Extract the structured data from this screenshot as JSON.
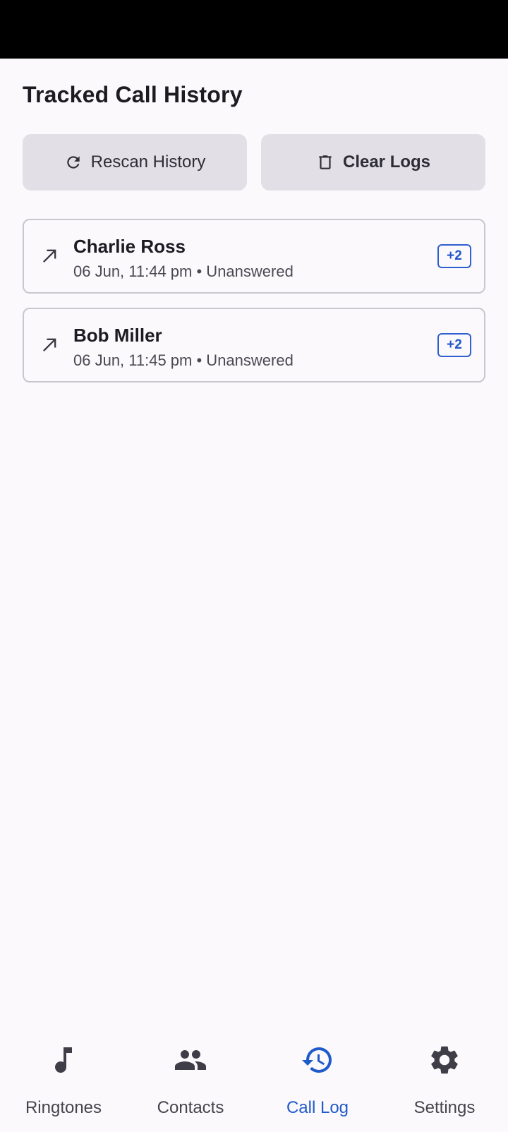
{
  "page": {
    "title": "Tracked Call History"
  },
  "actions": {
    "rescan_label": "Rescan History",
    "clear_label": "Clear Logs"
  },
  "calls": [
    {
      "name": "Charlie Ross",
      "meta": "06 Jun, 11:44 pm • Unanswered",
      "badge": "+2",
      "direction_icon": "outgoing-call-arrow"
    },
    {
      "name": "Bob Miller",
      "meta": "06 Jun, 11:45 pm • Unanswered",
      "badge": "+2",
      "direction_icon": "outgoing-call-arrow"
    }
  ],
  "nav": {
    "items": [
      {
        "label": "Ringtones",
        "icon": "music-note-icon"
      },
      {
        "label": "Contacts",
        "icon": "people-icon"
      },
      {
        "label": "Call Log",
        "icon": "history-icon",
        "active": true
      },
      {
        "label": "Settings",
        "icon": "gear-icon"
      }
    ]
  },
  "colors": {
    "background": "#fbf9fc",
    "button": "#e2e0e6",
    "accent": "#1f5acb",
    "card_border": "#c9c7cd"
  }
}
